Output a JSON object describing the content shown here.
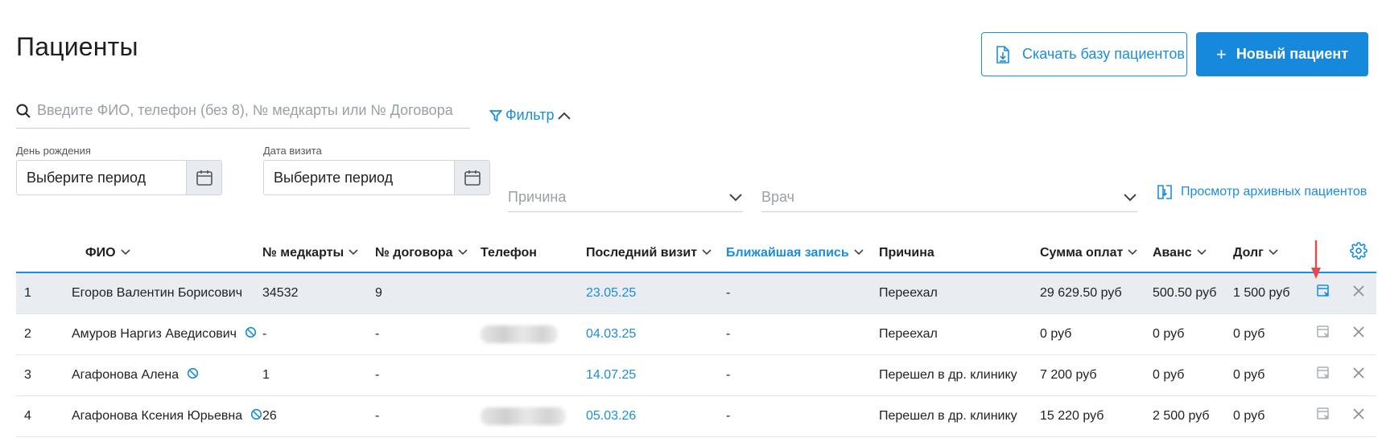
{
  "page": {
    "title": "Пациенты"
  },
  "actions": {
    "download_label": "Скачать базу пациентов",
    "new_patient_label": "Новый пациент",
    "new_patient_plus": "+"
  },
  "search": {
    "placeholder": "Введите ФИО, телефон (без 8), № медкарты или № Договора",
    "value": ""
  },
  "filter": {
    "label": "Фильтр"
  },
  "filters": {
    "birthday": {
      "label": "День рождения",
      "value": "Выберите период"
    },
    "visit_date": {
      "label": "Дата визита",
      "value": "Выберите период"
    },
    "reason": {
      "placeholder": "Причина"
    },
    "doctor": {
      "placeholder": "Врач"
    },
    "archive_link": "Просмотр архивных пациентов"
  },
  "table": {
    "columns": [
      {
        "key": "idx",
        "label": "",
        "sortable": false
      },
      {
        "key": "name",
        "label": "ФИО",
        "sortable": true
      },
      {
        "key": "card",
        "label": "№ медкарты",
        "sortable": true
      },
      {
        "key": "contract",
        "label": "№ договора",
        "sortable": true
      },
      {
        "key": "phone",
        "label": "Телефон",
        "sortable": false
      },
      {
        "key": "last_visit",
        "label": "Последний визит",
        "sortable": true
      },
      {
        "key": "next_appointment",
        "label": "Ближайшая запись",
        "sortable": true
      },
      {
        "key": "reason",
        "label": "Причина",
        "sortable": false
      },
      {
        "key": "payments",
        "label": "Сумма оплат",
        "sortable": true
      },
      {
        "key": "advance",
        "label": "Аванс",
        "sortable": true
      },
      {
        "key": "debt",
        "label": "Долг",
        "sortable": true
      }
    ],
    "rows": [
      {
        "idx": "1",
        "name": "Егоров Валентин Борисович",
        "blocked": false,
        "card": "34532",
        "contract": "9",
        "phone": "",
        "last_visit": "23.05.25",
        "next_appointment": "-",
        "reason": "Переехал",
        "payments": "29 629.50 руб",
        "advance": "500.50 руб",
        "debt": "1 500 руб"
      },
      {
        "idx": "2",
        "name": "Амуров Наргиз Аведисович",
        "blocked": true,
        "card": "-",
        "contract": "-",
        "phone": "hidden",
        "last_visit": "04.03.25",
        "next_appointment": "-",
        "reason": "Переехал",
        "payments": "0 руб",
        "advance": "0 руб",
        "debt": "0 руб"
      },
      {
        "idx": "3",
        "name": "Агафонова Алена",
        "blocked": true,
        "card": "1",
        "contract": "-",
        "phone": "",
        "last_visit": "14.07.25",
        "next_appointment": "-",
        "reason": "Перешел в др. клинику",
        "payments": "7 200 руб",
        "advance": "0 руб",
        "debt": "0 руб"
      },
      {
        "idx": "4",
        "name": "Агафонова Ксения Юрьевна",
        "blocked": true,
        "card": "26",
        "contract": "-",
        "phone": "hidden",
        "last_visit": "05.03.26",
        "next_appointment": "-",
        "reason": "Перешел в др. клинику",
        "payments": "15 220 руб",
        "advance": "2 500 руб",
        "debt": "0 руб"
      }
    ]
  },
  "colors": {
    "accent": "#1a8ddf",
    "selected_row": "#e9ecf0",
    "annotation_arrow": "#e8494b"
  },
  "icons": [
    "download-file-icon",
    "search-icon",
    "filter-icon",
    "chevron-up-icon",
    "calendar-icon",
    "chevron-down-icon",
    "archive-icon",
    "settings-gear-icon",
    "ban-icon",
    "archive-patient-icon",
    "close-icon",
    "red-arrow-annotation"
  ]
}
